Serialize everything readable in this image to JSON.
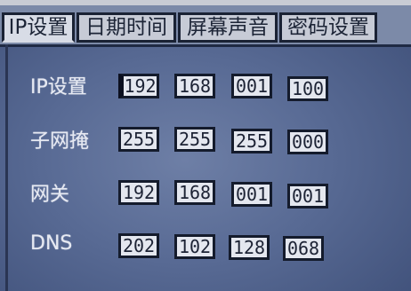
{
  "tabs": [
    {
      "label": "IP设置",
      "active": true
    },
    {
      "label": "日期时间",
      "active": false
    },
    {
      "label": "屏幕声音",
      "active": false
    },
    {
      "label": "密码设置",
      "active": false
    }
  ],
  "network": {
    "ip": {
      "label": "IP设置",
      "octets": [
        "192",
        "168",
        "001",
        "100"
      ]
    },
    "subnet": {
      "label": "子网掩",
      "octets": [
        "255",
        "255",
        "255",
        "000"
      ]
    },
    "gateway": {
      "label": "网关",
      "octets": [
        "192",
        "168",
        "001",
        "001"
      ]
    },
    "dns": {
      "label": "DNS",
      "octets": [
        "202",
        "102",
        "128",
        "068"
      ]
    }
  },
  "colors": {
    "screen": "#586a94",
    "tab_fill": "#c7cbd6",
    "field_fill": "#e4e7ef",
    "label_text": "#e6e9f2"
  }
}
